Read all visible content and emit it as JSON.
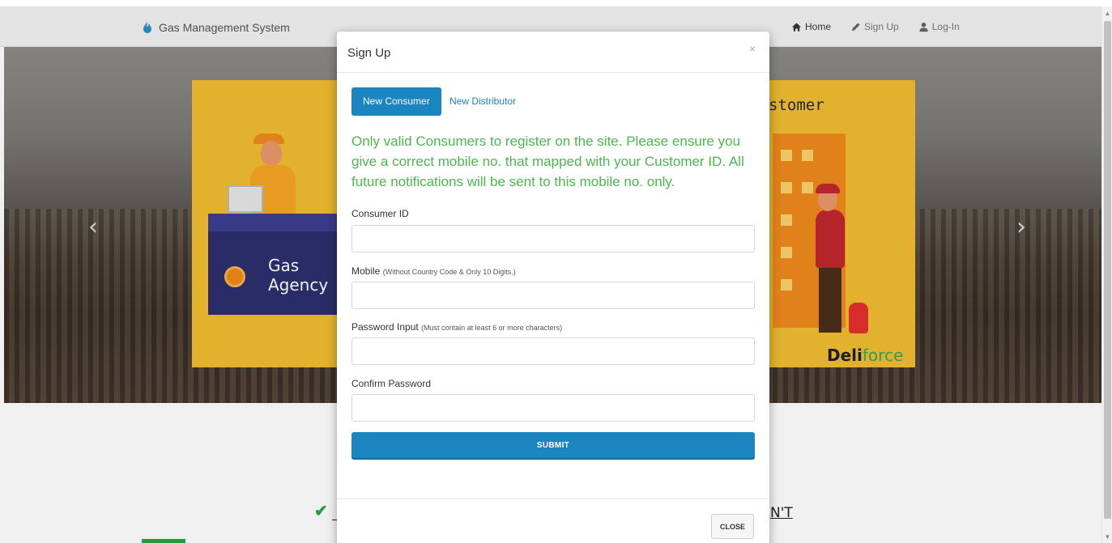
{
  "navbar": {
    "brand": "Gas Management System",
    "links": {
      "home": "Home",
      "signup": "Sign Up",
      "login": "Log-In"
    }
  },
  "carousel": {
    "slide": {
      "agency_line1": "Gas",
      "agency_line2": "Agency",
      "partial_title": "stomer",
      "logo_part1": "Deli",
      "logo_part2": "force"
    },
    "prev_glyph": "‹",
    "next_glyph": "›"
  },
  "below": {
    "check_glyph": "✔",
    "right_text": "N'T"
  },
  "modal": {
    "title": "Sign Up",
    "close_x": "×",
    "tabs": {
      "active": "New Consumer",
      "inactive": "New Distributor"
    },
    "notice": "Only valid Consumers to register on the site. Please ensure you give a correct mobile no. that mapped with your Customer ID. All future notifications will be sent to this mobile no. only.",
    "fields": {
      "consumer_id": {
        "label": "Consumer ID",
        "value": ""
      },
      "mobile": {
        "label": "Mobile",
        "hint": "(Without Country Code & Only 10 Digits.)",
        "value": ""
      },
      "password": {
        "label": "Password Input",
        "hint": "(Must contain at least 6 or more characters)",
        "value": ""
      },
      "confirm_password": {
        "label": "Confirm Password",
        "value": ""
      }
    },
    "submit_label": "SUBMIT",
    "close_label": "CLOSE"
  },
  "colors": {
    "primary": "#1a85bf",
    "notice_green": "#4cb84c",
    "slide_yellow": "#f1bd31"
  }
}
